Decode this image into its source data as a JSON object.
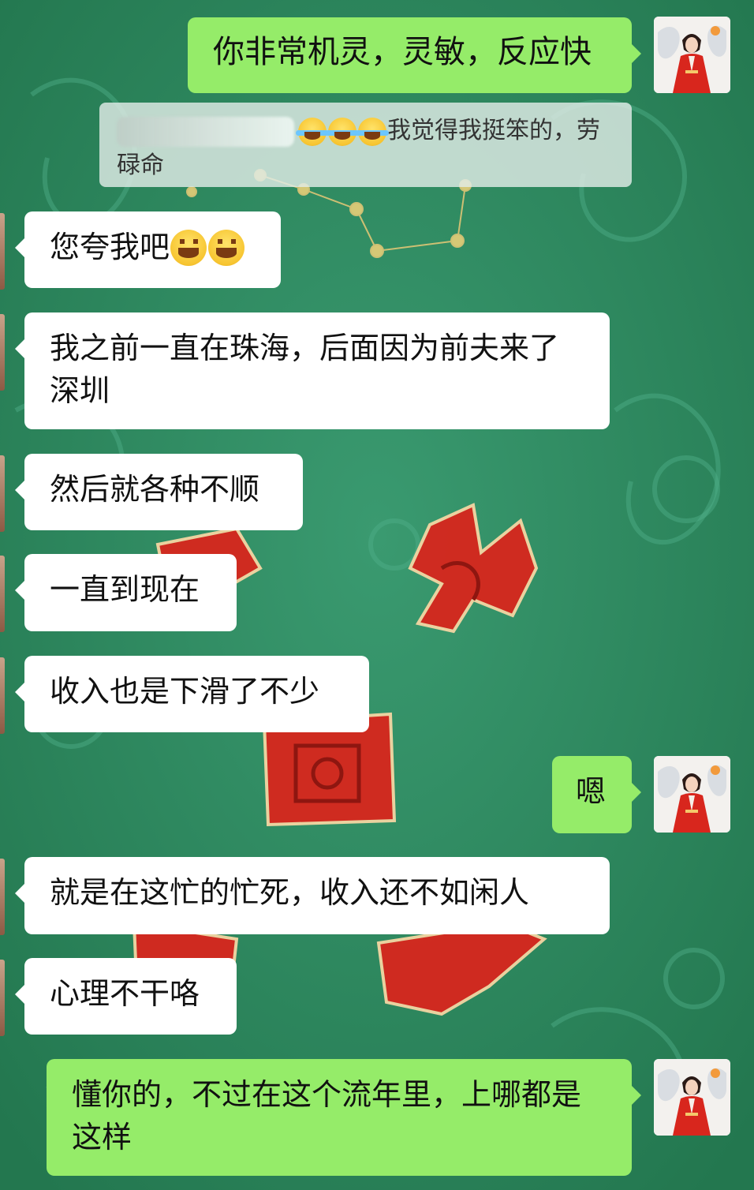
{
  "chat": {
    "messages": [
      {
        "id": "m1",
        "side": "right",
        "text": "你非常机灵，灵敏，反应快"
      },
      {
        "id": "m2",
        "side": "left",
        "text": "您夸我吧",
        "emoji": [
          "grin-emoji",
          "grin-emoji"
        ]
      },
      {
        "id": "m3",
        "side": "left",
        "text": "我之前一直在珠海，后面因为前夫来了深圳"
      },
      {
        "id": "m4",
        "side": "left",
        "text": "然后就各种不顺"
      },
      {
        "id": "m5",
        "side": "left",
        "text": "一直到现在"
      },
      {
        "id": "m6",
        "side": "left",
        "text": "收入也是下滑了不少"
      },
      {
        "id": "m7",
        "side": "right",
        "text": "嗯"
      },
      {
        "id": "m8",
        "side": "left",
        "text": "就是在这忙的忙死，收入还不如闲人"
      },
      {
        "id": "m9",
        "side": "left",
        "text": "心理不干咯"
      },
      {
        "id": "m10",
        "side": "right",
        "text": "懂你的，不过在这个流年里，上哪都是这样"
      }
    ],
    "quote": {
      "emoji": [
        "tears-of-joy-emoji",
        "tears-of-joy-emoji",
        "tears-of-joy-emoji"
      ],
      "text": "我觉得我挺笨的，劳碌命"
    }
  },
  "background": {
    "characters": [
      "飞",
      "回",
      "团",
      "来"
    ],
    "colors": {
      "green": "#2f8d65",
      "red": "#d8261d",
      "bubble_out": "#95ec69",
      "bubble_in": "#ffffff"
    }
  },
  "icons": {
    "self_avatar": "avatar-woman-red-hanfu",
    "other_avatar": "avatar-partial-edge"
  }
}
